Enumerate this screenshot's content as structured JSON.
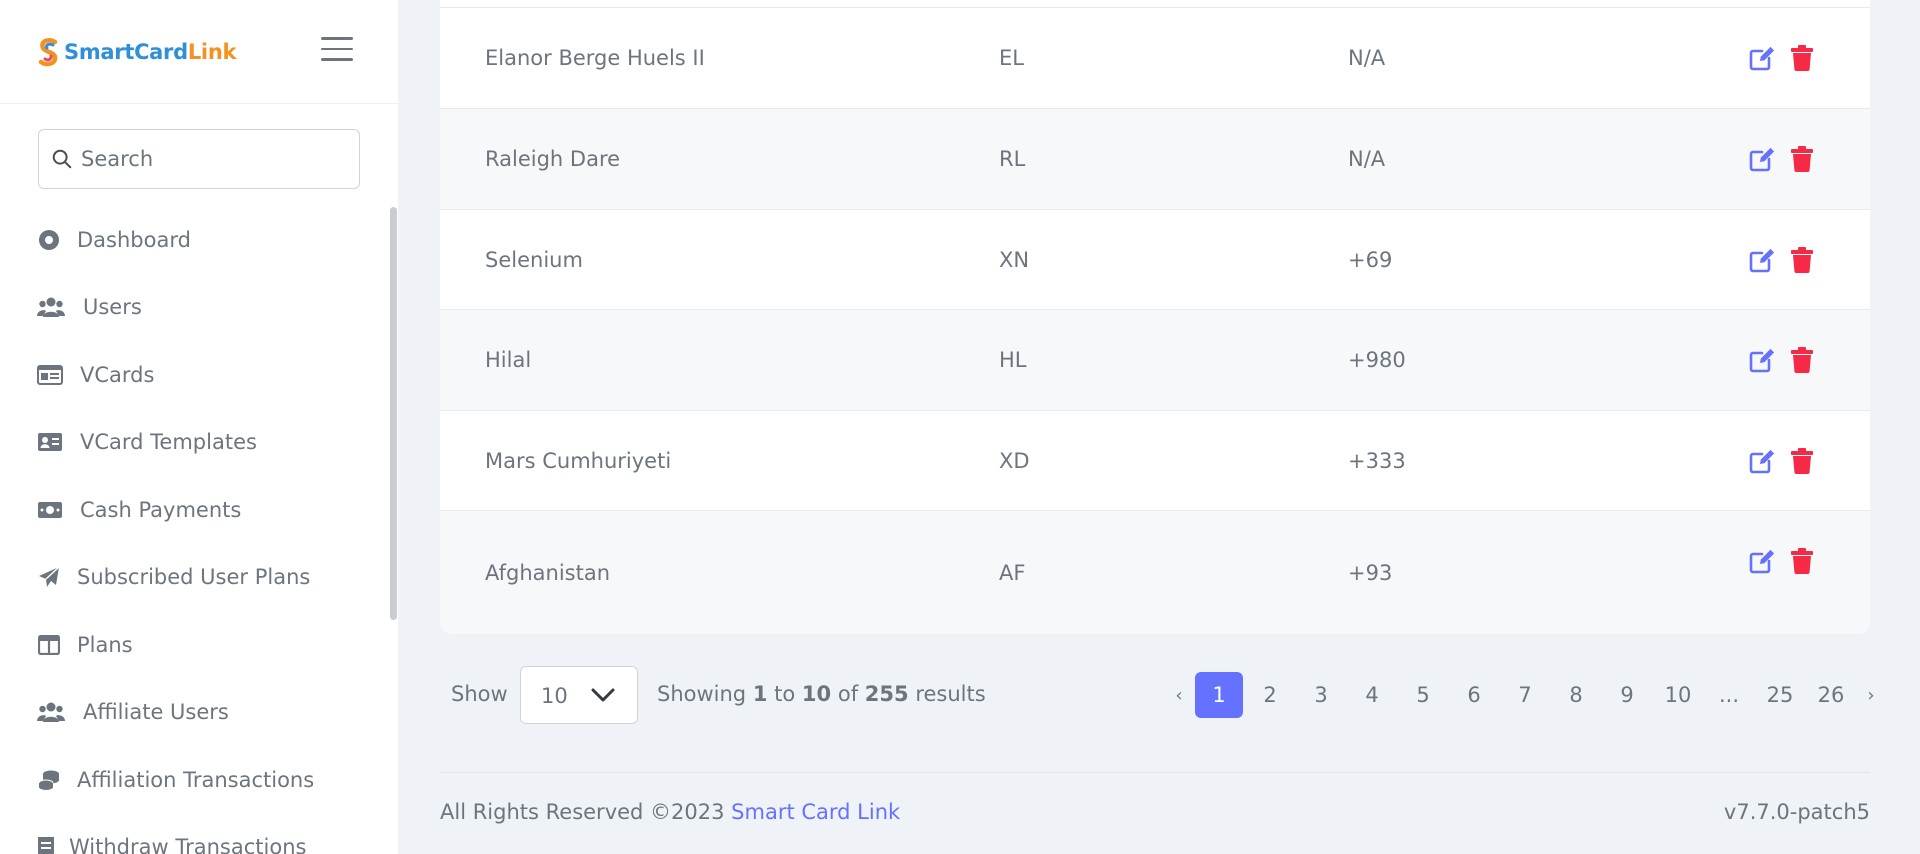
{
  "brand": {
    "part1": "SmartCard",
    "part2": "Link"
  },
  "search": {
    "placeholder": "Search"
  },
  "sidebar": {
    "items": [
      {
        "label": "Dashboard",
        "icon": "dashboard-icon"
      },
      {
        "label": "Users",
        "icon": "users-icon"
      },
      {
        "label": "VCards",
        "icon": "vcard-icon"
      },
      {
        "label": "VCard Templates",
        "icon": "id-card-icon"
      },
      {
        "label": "Cash Payments",
        "icon": "money-bill-icon"
      },
      {
        "label": "Subscribed User Plans",
        "icon": "paper-plane-icon"
      },
      {
        "label": "Plans",
        "icon": "table-columns-icon"
      },
      {
        "label": "Affiliate Users",
        "icon": "users-icon"
      },
      {
        "label": "Affiliation Transactions",
        "icon": "coins-icon"
      },
      {
        "label": "Withdraw Transactions",
        "icon": "receipt-icon"
      }
    ]
  },
  "table": {
    "rows": [
      {
        "name": "Elanor Berge Huels II",
        "code": "EL",
        "phone": "N/A"
      },
      {
        "name": "Raleigh Dare",
        "code": "RL",
        "phone": "N/A"
      },
      {
        "name": "Selenium",
        "code": "XN",
        "phone": "+69"
      },
      {
        "name": "Hilal",
        "code": "HL",
        "phone": "+980"
      },
      {
        "name": "Mars Cumhuriyeti",
        "code": "XD",
        "phone": "+333"
      },
      {
        "name": "Afghanistan",
        "code": "AF",
        "phone": "+93"
      }
    ]
  },
  "pagination": {
    "show_label": "Show",
    "per_page": "10",
    "showing_prefix": "Showing",
    "from": "1",
    "to_word": "to",
    "to": "10",
    "of_word": "of",
    "total": "255",
    "results_word": "results",
    "prev": "‹",
    "next": "›",
    "pages": [
      "1",
      "2",
      "3",
      "4",
      "5",
      "6",
      "7",
      "8",
      "9",
      "10",
      "...",
      "25",
      "26"
    ],
    "active_page": "1"
  },
  "footer": {
    "copyright": "All Rights Reserved ©2023",
    "link": "Smart Card Link",
    "version": "v7.7.0-patch5"
  },
  "colors": {
    "accent": "#6571ff",
    "danger": "#f62947",
    "logo_blue": "#2f8fd8",
    "logo_orange": "#f39223"
  }
}
